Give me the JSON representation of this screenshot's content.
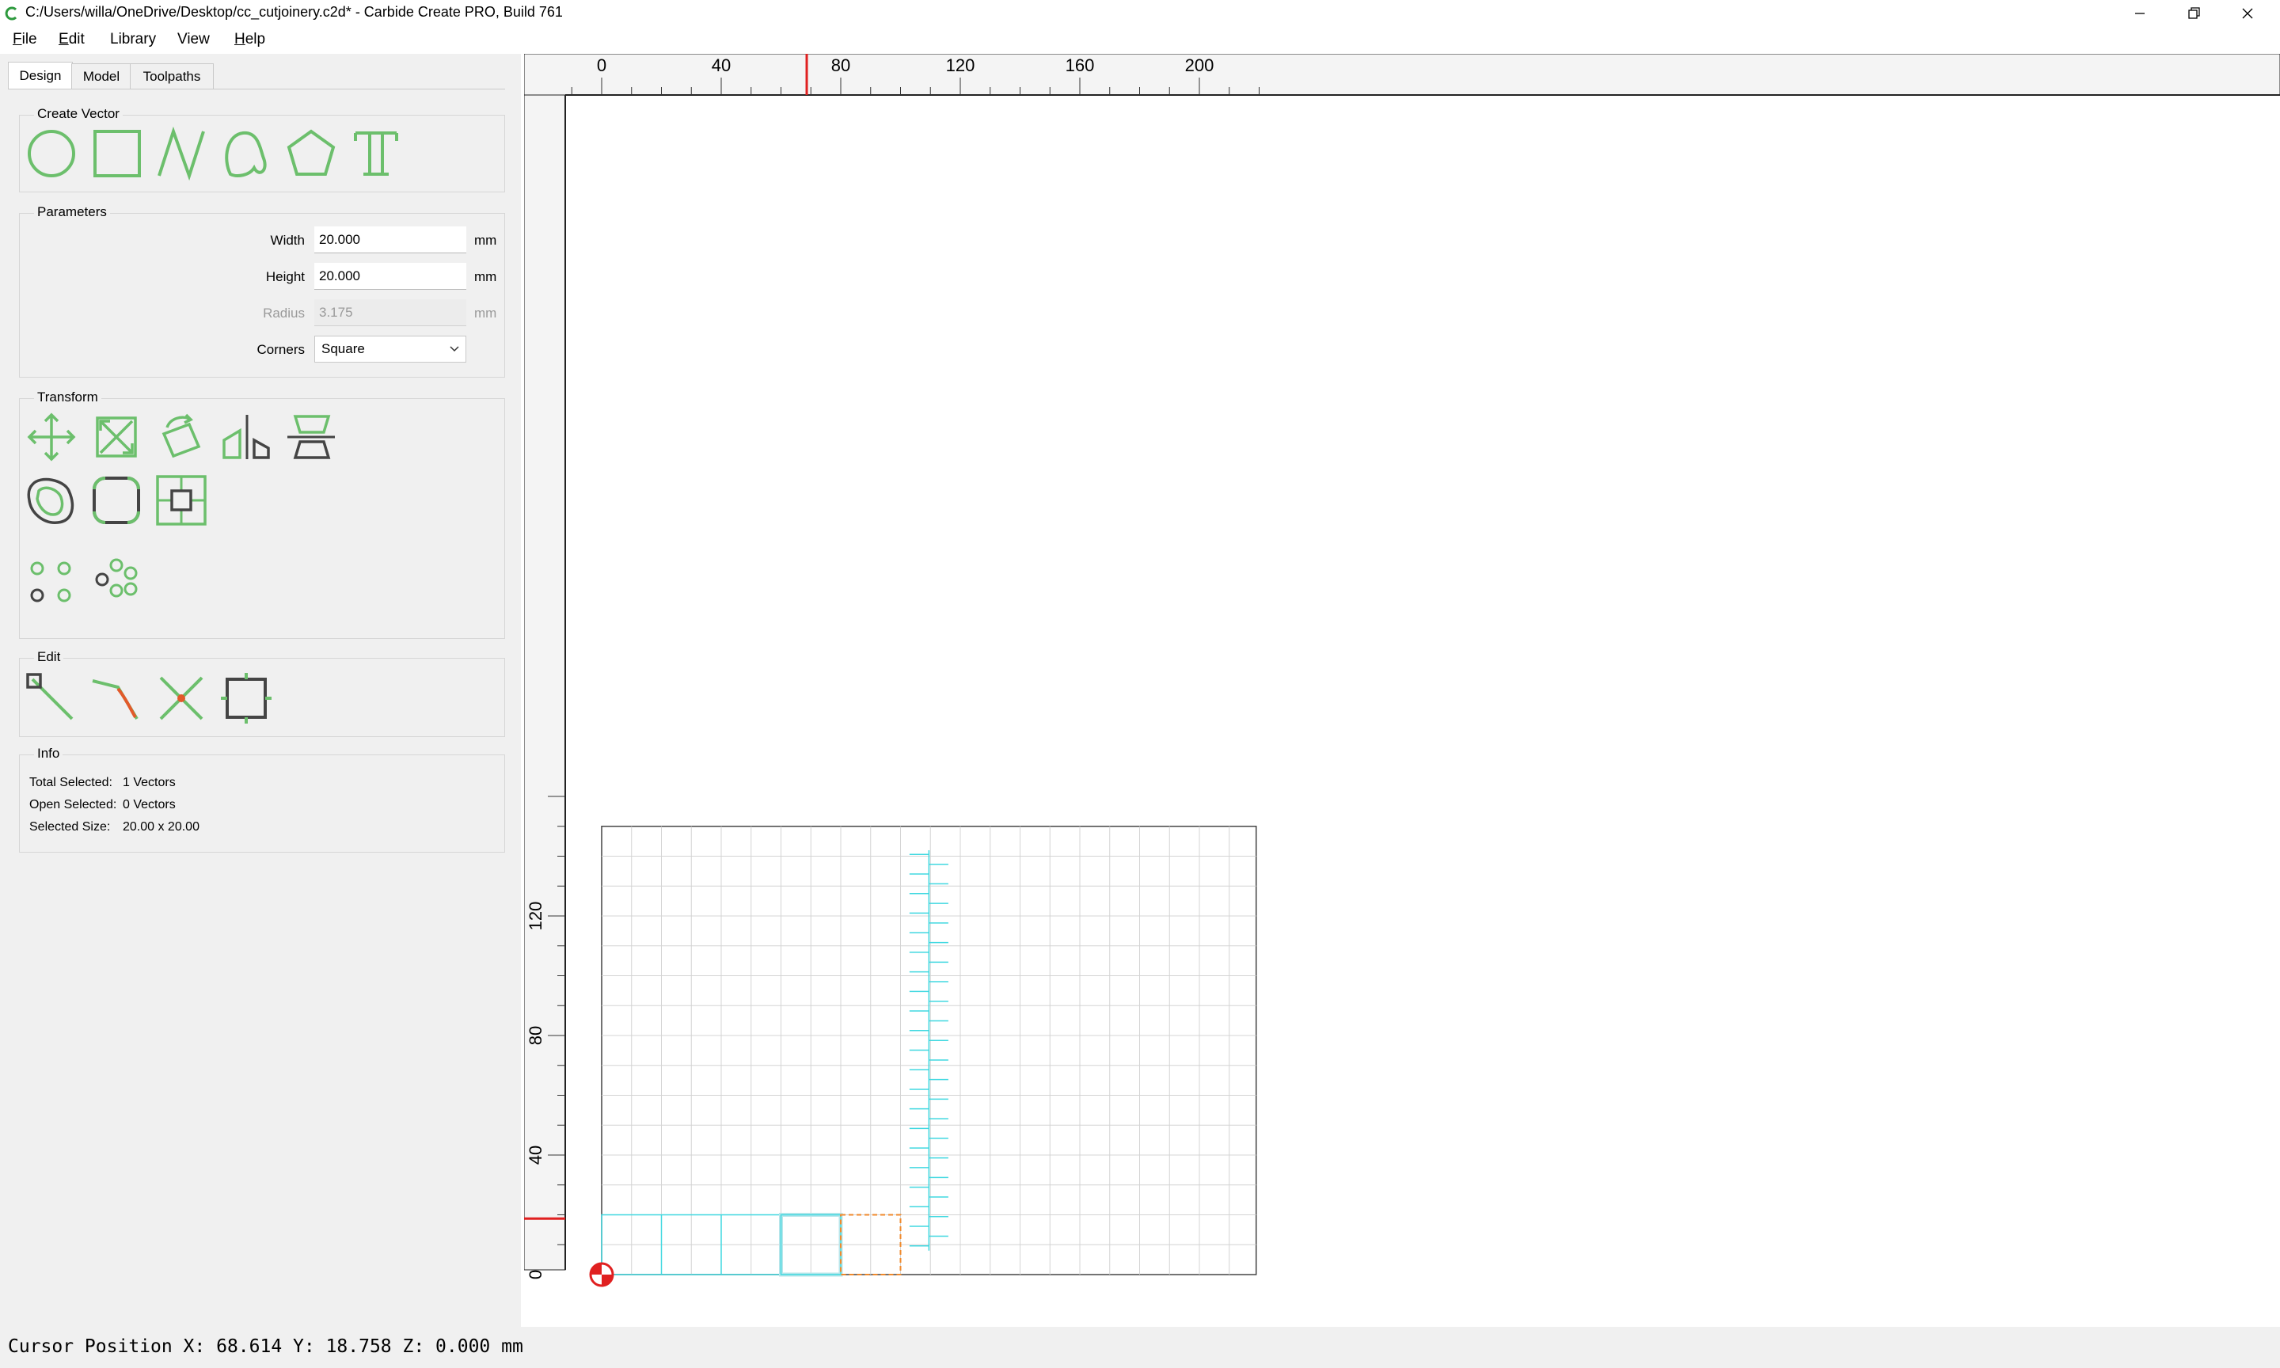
{
  "window": {
    "title": "C:/Users/willa/OneDrive/Desktop/cc_cutjoinery.c2d* - Carbide Create PRO, Build 761",
    "app_icon": "carbide-c-icon",
    "controls": [
      "minimize-icon",
      "restore-icon",
      "close-icon"
    ]
  },
  "menu": {
    "items": [
      {
        "label": "File",
        "accel": "F",
        "rest": "ile"
      },
      {
        "label": "Edit",
        "accel": "E",
        "rest": "dit"
      },
      {
        "label": "Library",
        "accel": "",
        "rest": "Library"
      },
      {
        "label": "View",
        "accel": "",
        "rest": "View"
      },
      {
        "label": "Help",
        "accel": "H",
        "rest": "elp"
      }
    ]
  },
  "tabs": {
    "design": "Design",
    "model": "Model",
    "toolpaths": "Toolpaths",
    "active": "Design"
  },
  "create_vector": {
    "title": "Create Vector",
    "tools": [
      "circle-icon",
      "rectangle-icon",
      "polyline-icon",
      "curve-icon",
      "polygon-icon",
      "text-icon"
    ]
  },
  "parameters": {
    "title": "Parameters",
    "width_label": "Width",
    "width_value": "20.000",
    "height_label": "Height",
    "height_value": "20.000",
    "radius_label": "Radius",
    "radius_value": "3.175",
    "unit": "mm",
    "corners_label": "Corners",
    "corners_value": "Square"
  },
  "transform": {
    "title": "Transform",
    "row1": [
      "move-icon",
      "scale-icon",
      "rotate-icon",
      "mirror-icon",
      "align-icon"
    ],
    "row2": [
      "offset-icon",
      "fillet-icon",
      "boolean-icon"
    ],
    "row3": [
      "circular-array-icon",
      "linear-array-icon"
    ]
  },
  "edit": {
    "title": "Edit",
    "tools": [
      "node-edit-icon",
      "curve-edit-icon",
      "trim-icon",
      "bounding-box-icon"
    ]
  },
  "info": {
    "title": "Info",
    "total_label": "Total Selected:",
    "total_value": "1 Vectors",
    "open_label": "Open Selected:",
    "open_value": "0 Vectors",
    "size_label": "Selected Size:",
    "size_value": "20.00 x 20.00"
  },
  "rulers": {
    "x_ticks": [
      "0",
      "40",
      "80",
      "120",
      "160",
      "200"
    ],
    "y_ticks": [
      "0",
      "40",
      "80",
      "120"
    ]
  },
  "cursor": {
    "x": 68.614,
    "y": 18.758,
    "text": "Cursor Position X: 68.614 Y: 18.758 Z: 0.000 mm"
  },
  "colors": {
    "accent_green": "#6cbf6c",
    "vector_cyan": "#40d8e0",
    "selected_orange": "#f08a2c",
    "ruler_marker": "#e02020"
  }
}
